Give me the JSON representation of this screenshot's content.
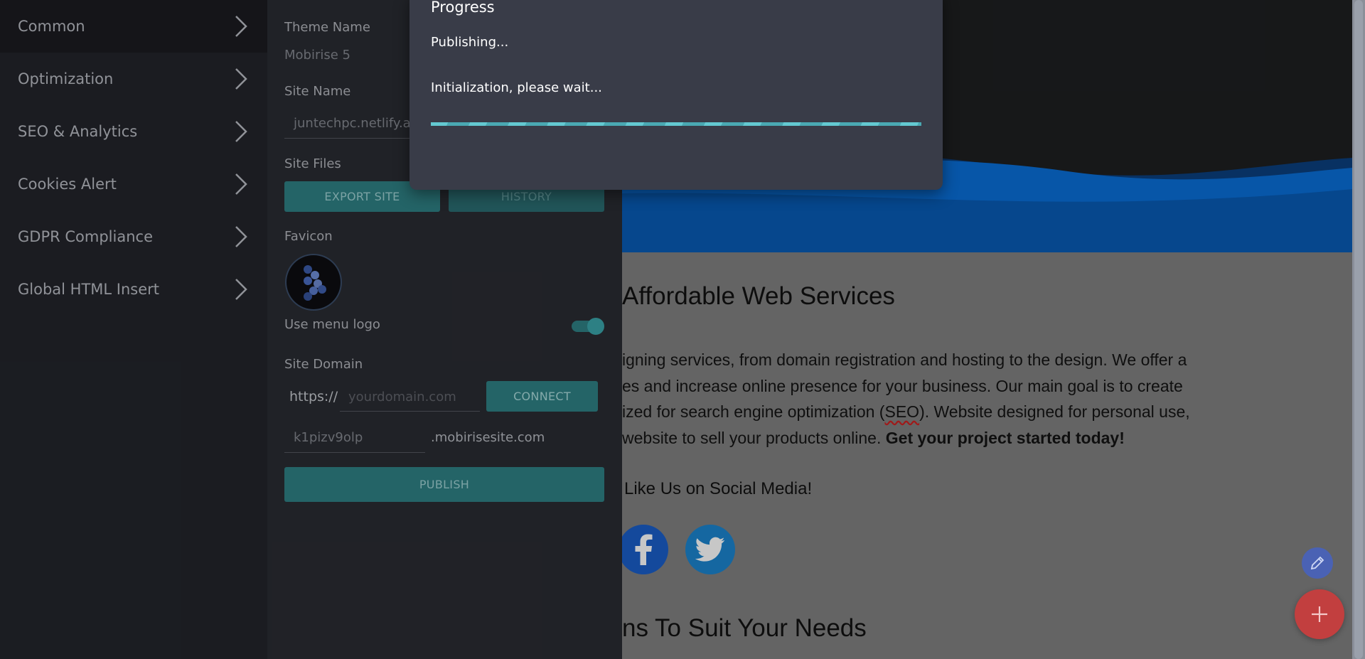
{
  "left_menu": {
    "items": [
      {
        "label": "Common",
        "icon": "chevron-right-icon"
      },
      {
        "label": "Optimization",
        "icon": "chevron-right-icon"
      },
      {
        "label": "SEO & Analytics",
        "icon": "chevron-right-icon"
      },
      {
        "label": "Cookies Alert",
        "icon": "chevron-right-icon"
      },
      {
        "label": "GDPR Compliance",
        "icon": "chevron-right-icon"
      },
      {
        "label": "Global HTML Insert",
        "icon": "chevron-right-icon"
      }
    ],
    "active_item": "Common"
  },
  "settings": {
    "theme_name_label": "Theme Name",
    "theme_name_value": "Mobirise 5",
    "site_name_label": "Site Name",
    "site_name_value": "juntechpc.netlify.ap",
    "site_files_label": "Site Files",
    "export_site_button": "EXPORT SITE",
    "history_button": "HISTORY",
    "favicon_label": "Favicon",
    "use_menu_logo_label": "Use menu logo",
    "use_menu_logo_enabled": true,
    "site_domain_label": "Site Domain",
    "domain_prefix": "https://",
    "domain_placeholder": "yourdomain.com",
    "connect_button": "CONNECT",
    "subdomain_value": "k1pizv9olp",
    "subdomain_suffix": ".mobirisesite.com",
    "publish_button": "PUBLISH"
  },
  "modal": {
    "title": "Progress",
    "status": "Publishing...",
    "detail": "Initialization, please wait...",
    "progress_fraction": 1.0
  },
  "site_preview": {
    "heading": "Affordable Web Services",
    "body_lines": [
      {
        "before": "igning services, from domain registration and hosting to the design. We offer a"
      },
      {
        "before": "es and increase online presence for your business. Our main goal is to create"
      },
      {
        "before": "ized for search engine optimization (",
        "seo": "SEO",
        "after": "). Website designed for personal use,"
      },
      {
        "before": " website to sell your products online. ",
        "strong": "Get your project started today!"
      }
    ],
    "social_label": "Like Us on Social Media!",
    "social_icons": [
      "facebook-icon",
      "twitter-icon"
    ],
    "heading2": "ns To Suit Your Needs"
  },
  "floating_buttons": {
    "edit_icon": "pencil-icon",
    "add_icon": "plus-icon"
  },
  "colors": {
    "accent_teal": "#2f8084",
    "menu_bg": "#23252b",
    "panel_bg": "#2a2c32",
    "modal_bg": "#393c48",
    "fab_add": "#c23f3f",
    "fab_edit": "#4a62b4",
    "hero_blue": "#0a6fd8"
  }
}
